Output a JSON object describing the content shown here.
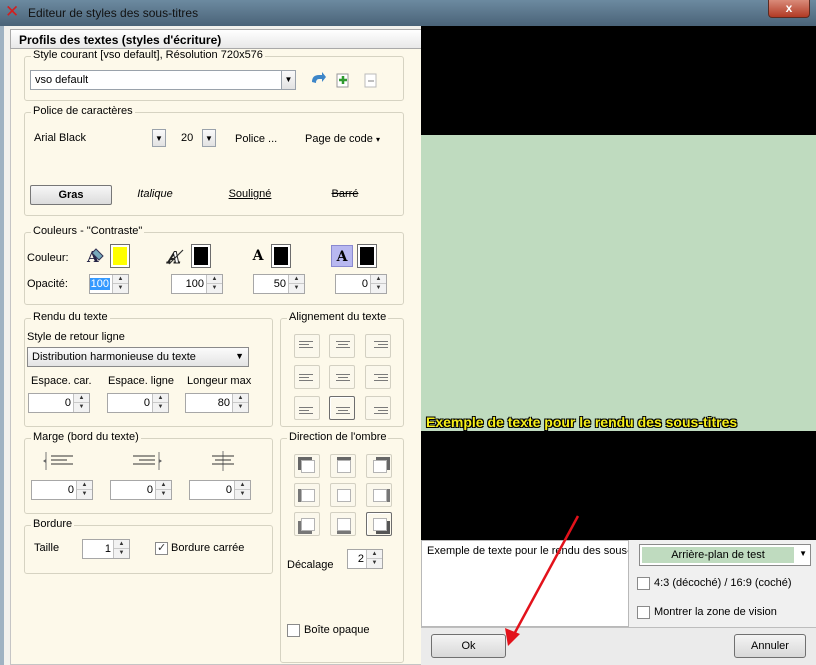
{
  "window": {
    "title": "Editeur de styles des sous-titres",
    "close_label": "x"
  },
  "panel": {
    "header": "Profils des textes (styles d'écriture)"
  },
  "style_group": {
    "title": "Style courant [vso default], Résolution 720x576",
    "selected": "vso default"
  },
  "font_group": {
    "title": "Police de caractères",
    "font": "Arial Black",
    "size": "20",
    "font_button": "Police ...",
    "codepage": "Page de code",
    "bold": "Gras",
    "italic": "Italique",
    "underline": "Souligné",
    "strike": "Barré"
  },
  "colors_group": {
    "title": "Couleurs - \"Contraste\"",
    "color_label": "Couleur:",
    "opacity_label": "Opacité:",
    "swatches": [
      "#ffff00",
      "#000000",
      "#000000",
      "#000000"
    ],
    "opacities": [
      "100",
      "100",
      "50",
      "0"
    ]
  },
  "render_group": {
    "title": "Rendu du texte",
    "wrap_label": "Style de retour ligne",
    "wrap_value": "Distribution harmonieuse du texte",
    "char_spacing_label": "Espace. car.",
    "char_spacing": "0",
    "line_spacing_label": "Espace. ligne",
    "line_spacing": "0",
    "max_length_label": "Longeur max",
    "max_length": "80"
  },
  "align_group": {
    "title": "Alignement du texte"
  },
  "margin_group": {
    "title": "Marge (bord du texte)",
    "values": [
      "0",
      "0",
      "0"
    ]
  },
  "shadow_group": {
    "title": "Direction de l'ombre",
    "offset_label": "Décalage",
    "offset": "2",
    "opaque_box": "Boîte opaque"
  },
  "border_group": {
    "title": "Bordure",
    "size_label": "Taille",
    "size": "1",
    "square_label": "Bordure carrée"
  },
  "preview": {
    "sample": "Exemple de texte pour le rendu des sous-titres",
    "input_text": "Exemple de texte pour le rendu des sous-",
    "background_button": "Arrière-plan de test",
    "aspect_label": "4:3 (décoché) / 16:9 (coché)",
    "vision_label": "Montrer la zone de vision"
  },
  "buttons": {
    "ok": "Ok",
    "cancel": "Annuler"
  }
}
